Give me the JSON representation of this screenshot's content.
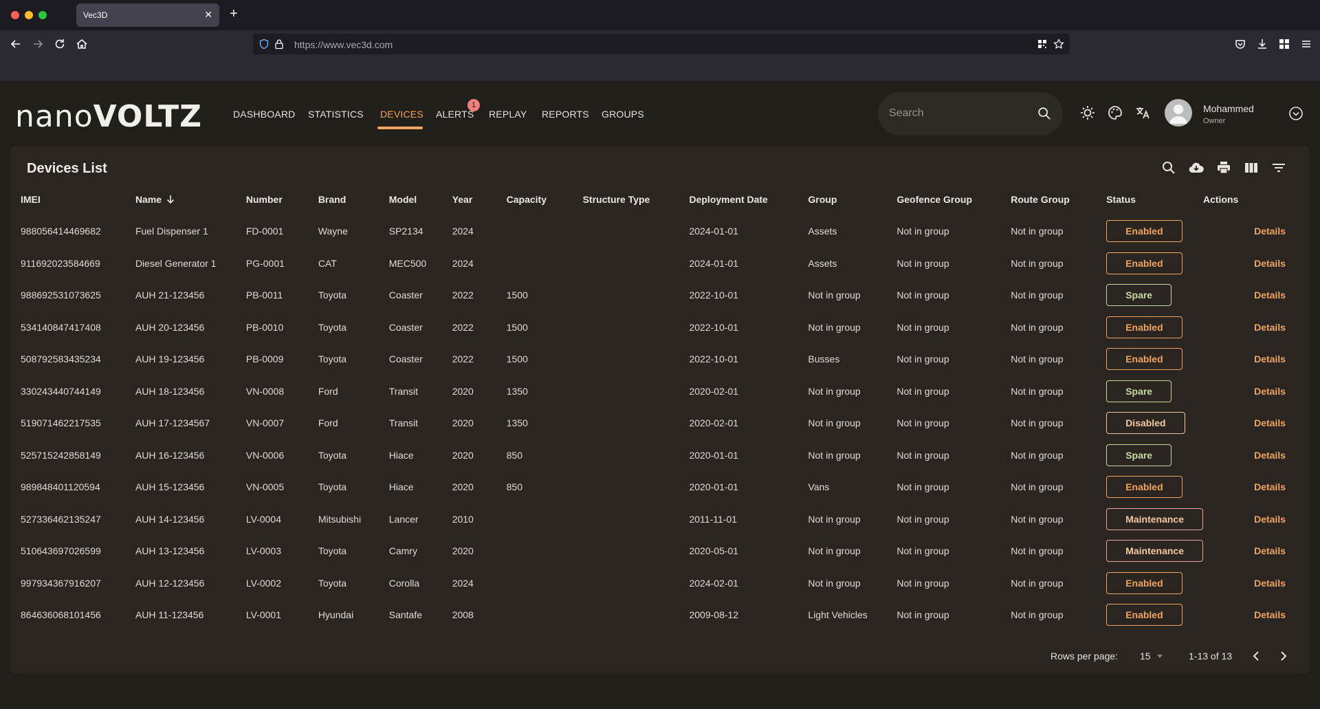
{
  "browser": {
    "tab_title": "Vec3D",
    "url": "https://www.vec3d.com"
  },
  "app": {
    "logo": {
      "part1": "nano",
      "part2": "VOLTZ"
    },
    "nav": [
      {
        "label": "DASHBOARD"
      },
      {
        "label": "STATISTICS"
      },
      {
        "label": "DEVICES",
        "active": true
      },
      {
        "label": "ALERTS",
        "badge": "1"
      },
      {
        "label": "REPLAY"
      },
      {
        "label": "REPORTS"
      },
      {
        "label": "GROUPS"
      }
    ],
    "search_placeholder": "Search",
    "user": {
      "name": "Mohammed",
      "role": "Owner"
    }
  },
  "card": {
    "title": "Devices List",
    "columns": [
      "IMEI",
      "Name",
      "Number",
      "Brand",
      "Model",
      "Year",
      "Capacity",
      "Structure Type",
      "Deployment Date",
      "Group",
      "Geofence Group",
      "Route Group",
      "Status",
      "Actions"
    ],
    "rows": [
      [
        "988056414469682",
        "Fuel Dispenser 1",
        "FD-0001",
        "Wayne",
        "SP2134",
        "2024",
        "",
        "",
        "2024-01-01",
        "Assets",
        "Not in group",
        "Not in group",
        "Enabled",
        "Details"
      ],
      [
        "911692023584669",
        "Diesel Generator 1",
        "PG-0001",
        "CAT",
        "MEC500",
        "2024",
        "",
        "",
        "2024-01-01",
        "Assets",
        "Not in group",
        "Not in group",
        "Enabled",
        "Details"
      ],
      [
        "988692531073625",
        "AUH 21-123456",
        "PB-0011",
        "Toyota",
        "Coaster",
        "2022",
        "1500",
        "",
        "2022-10-01",
        "Not in group",
        "Not in group",
        "Not in group",
        "Spare",
        "Details"
      ],
      [
        "534140847417408",
        "AUH 20-123456",
        "PB-0010",
        "Toyota",
        "Coaster",
        "2022",
        "1500",
        "",
        "2022-10-01",
        "Not in group",
        "Not in group",
        "Not in group",
        "Enabled",
        "Details"
      ],
      [
        "508792583435234",
        "AUH 19-123456",
        "PB-0009",
        "Toyota",
        "Coaster",
        "2022",
        "1500",
        "",
        "2022-10-01",
        "Busses",
        "Not in group",
        "Not in group",
        "Enabled",
        "Details"
      ],
      [
        "330243440744149",
        "AUH 18-123456",
        "VN-0008",
        "Ford",
        "Transit",
        "2020",
        "1350",
        "",
        "2020-02-01",
        "Not in group",
        "Not in group",
        "Not in group",
        "Spare",
        "Details"
      ],
      [
        "519071462217535",
        "AUH 17-1234567",
        "VN-0007",
        "Ford",
        "Transit",
        "2020",
        "1350",
        "",
        "2020-02-01",
        "Not in group",
        "Not in group",
        "Not in group",
        "Disabled",
        "Details"
      ],
      [
        "525715242858149",
        "AUH 16-123456",
        "VN-0006",
        "Toyota",
        "Hiace",
        "2020",
        "850",
        "",
        "2020-01-01",
        "Not in group",
        "Not in group",
        "Not in group",
        "Spare",
        "Details"
      ],
      [
        "989848401120594",
        "AUH 15-123456",
        "VN-0005",
        "Toyota",
        "Hiace",
        "2020",
        "850",
        "",
        "2020-01-01",
        "Vans",
        "Not in group",
        "Not in group",
        "Enabled",
        "Details"
      ],
      [
        "527336462135247",
        "AUH 14-123456",
        "LV-0004",
        "Mitsubishi",
        "Lancer",
        "2010",
        "",
        "",
        "2011-11-01",
        "Not in group",
        "Not in group",
        "Not in group",
        "Maintenance",
        "Details"
      ],
      [
        "510643697026599",
        "AUH 13-123456",
        "LV-0003",
        "Toyota",
        "Camry",
        "2020",
        "",
        "",
        "2020-05-01",
        "Not in group",
        "Not in group",
        "Not in group",
        "Maintenance",
        "Details"
      ],
      [
        "997934367916207",
        "AUH 12-123456",
        "LV-0002",
        "Toyota",
        "Corolla",
        "2024",
        "",
        "",
        "2024-02-01",
        "Not in group",
        "Not in group",
        "Not in group",
        "Enabled",
        "Details"
      ],
      [
        "864636068101456",
        "AUH 11-123456",
        "LV-0001",
        "Hyundai",
        "Santafe",
        "2008",
        "",
        "",
        "2009-08-12",
        "Light Vehicles",
        "Not in group",
        "Not in group",
        "Enabled",
        "Details"
      ]
    ],
    "footer": {
      "rows_per_page_label": "Rows per page:",
      "rows_per_page_value": "15",
      "range": "1-13 of 13"
    }
  },
  "colors": {
    "accent": "#f0a45e",
    "spare": "#c9d9a2",
    "maintenance": "#f0a4a4",
    "background": "#221e19",
    "card": "#2a2521"
  },
  "icons": [
    "back-icon",
    "forward-icon",
    "reload-icon",
    "home-icon",
    "shield-icon",
    "lock-icon",
    "qr-icon",
    "star-icon",
    "pocket-icon",
    "download-icon",
    "extensions-icon",
    "menu-icon",
    "search-icon",
    "sun-icon",
    "palette-icon",
    "translate-icon",
    "chevron-down-icon",
    "cloud-download-icon",
    "print-icon",
    "columns-icon",
    "filter-icon",
    "sort-down-icon",
    "prev-page-icon",
    "next-page-icon"
  ]
}
